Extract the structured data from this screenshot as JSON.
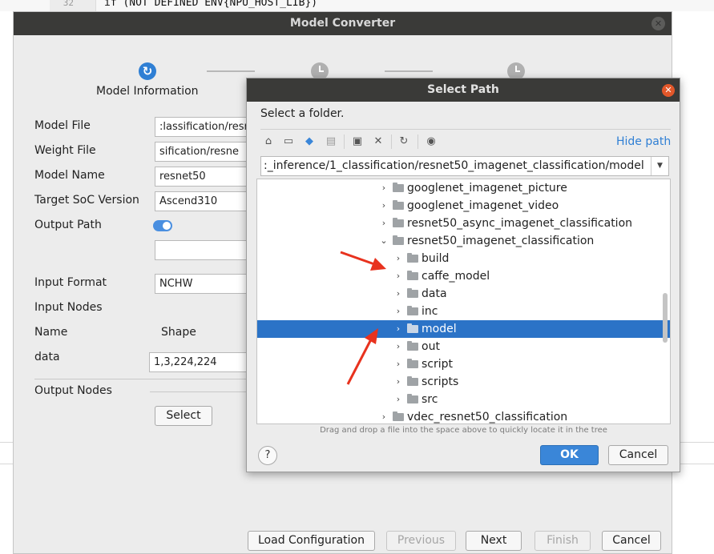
{
  "editor": {
    "line_number": "32",
    "code": "if (NOT DEFINED ENV{NPU_HOST_LIB})"
  },
  "model_converter": {
    "title": "Model Converter",
    "steps": [
      {
        "label": "Model Information",
        "state": "active"
      },
      {
        "state": "pending"
      },
      {
        "state": "pending"
      }
    ],
    "fields": {
      "model_file": {
        "label": "Model File",
        "value": ":lassification/resn"
      },
      "weight_file": {
        "label": "Weight File",
        "value": "sification/resne"
      },
      "model_name": {
        "label": "Model Name",
        "value": "resnet50"
      },
      "target_soc": {
        "label": "Target SoC Version",
        "value": "Ascend310"
      },
      "output_path": {
        "label": "Output Path",
        "toggle": "on",
        "value": ""
      },
      "input_format": {
        "label": "Input Format",
        "value": "NCHW"
      }
    },
    "input_nodes": {
      "label": "Input Nodes",
      "columns": [
        "Name",
        "Shape"
      ],
      "rows": [
        {
          "name": "data",
          "shape": "1,3,224,224"
        }
      ]
    },
    "output_nodes": {
      "label": "Output Nodes",
      "select_label": "Select"
    },
    "footer": {
      "load_configuration": "Load Configuration",
      "previous": "Previous",
      "next": "Next",
      "finish": "Finish",
      "cancel": "Cancel"
    }
  },
  "select_path": {
    "title": "Select Path",
    "subtitle": "Select a folder.",
    "toolbar_icons": [
      "home-icon",
      "desktop-icon",
      "project-icon",
      "module-icon",
      "new-folder-icon",
      "delete-icon",
      "refresh-icon",
      "show-hidden-icon"
    ],
    "hide_path_label": "Hide path",
    "path": ":_inference/1_classification/resnet50_imagenet_classification/model",
    "tree": [
      {
        "name": "googlenet_imagenet_picture",
        "level": 0,
        "expanded": false
      },
      {
        "name": "googlenet_imagenet_video",
        "level": 0,
        "expanded": false
      },
      {
        "name": "resnet50_async_imagenet_classification",
        "level": 0,
        "expanded": false
      },
      {
        "name": "resnet50_imagenet_classification",
        "level": 0,
        "expanded": true
      },
      {
        "name": "build",
        "level": 1,
        "expanded": false
      },
      {
        "name": "caffe_model",
        "level": 1,
        "expanded": false
      },
      {
        "name": "data",
        "level": 1,
        "expanded": false
      },
      {
        "name": "inc",
        "level": 1,
        "expanded": false
      },
      {
        "name": "model",
        "level": 1,
        "expanded": false,
        "selected": true
      },
      {
        "name": "out",
        "level": 1,
        "expanded": false
      },
      {
        "name": "script",
        "level": 1,
        "expanded": false
      },
      {
        "name": "scripts",
        "level": 1,
        "expanded": false
      },
      {
        "name": "src",
        "level": 1,
        "expanded": false
      },
      {
        "name": "vdec_resnet50_classification",
        "level": 0,
        "expanded": false
      }
    ],
    "hint": "Drag and drop a file into the space above to quickly locate it in the tree",
    "help_label": "?",
    "ok_label": "OK",
    "cancel_label": "Cancel"
  },
  "colors": {
    "accent": "#2f7fd4",
    "selection": "#2b73c7",
    "titlebar": "#3a3a38",
    "annotation_arrow": "#e8321e"
  }
}
